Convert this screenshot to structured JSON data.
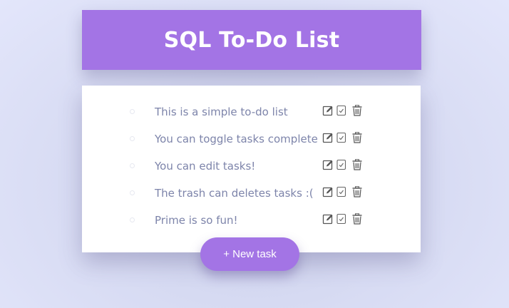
{
  "header": {
    "title": "SQL To-Do List"
  },
  "tasks": [
    {
      "text": "This is a simple to-do list"
    },
    {
      "text": "You can toggle tasks complete"
    },
    {
      "text": "You can edit tasks!"
    },
    {
      "text": "The trash can deletes tasks :("
    },
    {
      "text": "Prime is so fun!"
    }
  ],
  "icons": {
    "edit": "pencil-square-icon",
    "complete": "checkbox-icon",
    "delete": "trash-icon"
  },
  "new_task_button": {
    "label": "+ New task"
  },
  "colors": {
    "accent": "#a374e5",
    "task_text": "#7d84aa",
    "background": "#dfe2f8",
    "card": "#ffffff"
  }
}
